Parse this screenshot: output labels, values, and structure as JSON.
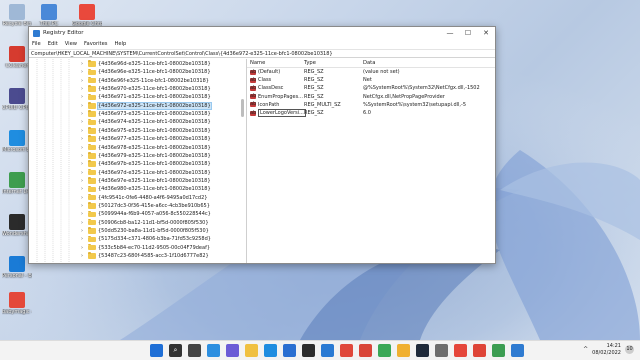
{
  "window": {
    "title": "Registry Editor",
    "menu": [
      "File",
      "Edit",
      "View",
      "Favorites",
      "Help"
    ],
    "address": "Computer\\HKEY_LOCAL_MACHINE\\SYSTEM\\CurrentControlSet\\Control\\Class\\{4d36e972-e325-11ce-bfc1-08002be10318}",
    "min": "—",
    "max": "☐",
    "close": "✕"
  },
  "tree": {
    "items": [
      {
        "key": "{4d36e96d-e325-11ce-bfc1-08002be10318}"
      },
      {
        "key": "{4d36e96e-e325-11ce-bfc1-08002be10318}"
      },
      {
        "key": "{4d36e96f-e325-11ce-bfc1-08002be10318}"
      },
      {
        "key": "{4d36e970-e325-11ce-bfc1-08002be10318}"
      },
      {
        "key": "{4d36e971-e325-11ce-bfc1-08002be10318}"
      },
      {
        "key": "{4d36e972-e325-11ce-bfc1-08002be10318}",
        "selected": true
      },
      {
        "key": "{4d36e973-e325-11ce-bfc1-08002be10318}"
      },
      {
        "key": "{4d36e974-e325-11ce-bfc1-08002be10318}"
      },
      {
        "key": "{4d36e975-e325-11ce-bfc1-08002be10318}"
      },
      {
        "key": "{4d36e977-e325-11ce-bfc1-08002be10318}"
      },
      {
        "key": "{4d36e978-e325-11ce-bfc1-08002be10318}"
      },
      {
        "key": "{4d36e979-e325-11ce-bfc1-08002be10318}"
      },
      {
        "key": "{4d36e97b-e325-11ce-bfc1-08002be10318}"
      },
      {
        "key": "{4d36e97d-e325-11ce-bfc1-08002be10318}"
      },
      {
        "key": "{4d36e97e-e325-11ce-bfc1-08002be10318}"
      },
      {
        "key": "{4d36e980-e325-11ce-bfc1-08002be10318}"
      },
      {
        "key": "{4fc9541c-0fe6-4480-a4f6-9495a0d17cd2}"
      },
      {
        "key": "{50127dc3-0f36-415e-a6cc-4cb3be910b65}"
      },
      {
        "key": "{5099944a-f6b9-4057-a056-8c550228544c}"
      },
      {
        "key": "{50906cb8-ba12-11d1-bf5d-0000f805f530}"
      },
      {
        "key": "{50dd5230-ba8a-11d1-bf5d-0000f805f530}"
      },
      {
        "key": "{5175d334-c371-4806-b3ba-71fd53c9258d}"
      },
      {
        "key": "{533c5b84-ec70-11d2-9505-00c04F79deaf}"
      },
      {
        "key": "{53487c23-680f-4585-acc3-1f10d6777e82}"
      }
    ]
  },
  "values": {
    "headers": {
      "name": "Name",
      "type": "Type",
      "data": "Data"
    },
    "rows": [
      {
        "name": "(Default)",
        "type": "REG_SZ",
        "data": "(value not set)"
      },
      {
        "name": "Class",
        "type": "REG_SZ",
        "data": "Net"
      },
      {
        "name": "ClassDesc",
        "type": "REG_SZ",
        "data": "@%SystemRoot%\\System32\\NetCfgx.dll,-1502"
      },
      {
        "name": "EnumPropPages...",
        "type": "REG_SZ",
        "data": "NetCfgx.dll,NetPropPageProvider"
      },
      {
        "name": "IconPath",
        "type": "REG_MULTI_SZ",
        "data": "%SystemRoot%\\system32\\setupapi.dll,-5"
      },
      {
        "name": "LowerLogoVersi...",
        "type": "REG_SZ",
        "data": "6.0",
        "editing": true
      }
    ]
  },
  "desktop": {
    "icons": [
      {
        "label": "Recycle Bin",
        "color": "#9fb8d6"
      },
      {
        "label": "This PC",
        "color": "#4a89d8"
      },
      {
        "label": "Google Chrome",
        "color": "#e9493c"
      },
      {
        "label": "CCleaner",
        "color": "#d63b2f"
      },
      {
        "label": "CPUID CPU-Z",
        "color": "#4b4b8f"
      },
      {
        "label": "Microsoft Edge",
        "color": "#1f8de0"
      },
      {
        "label": "Internet Download",
        "color": "#3e9d4f"
      },
      {
        "label": "Wondershare Filmora",
        "color": "#2b2b2b"
      },
      {
        "label": "Personal - Edge",
        "color": "#1a7bd6"
      },
      {
        "label": "babymagic - Chrome",
        "color": "#e4483a"
      }
    ]
  },
  "taskbar": {
    "icons": [
      {
        "name": "start-icon",
        "glyph": "",
        "color": "#1f6fd6"
      },
      {
        "name": "search-icon",
        "glyph": "⌕",
        "color": "#333333"
      },
      {
        "name": "task-view-icon",
        "glyph": "",
        "color": "#444444"
      },
      {
        "name": "widgets-icon",
        "glyph": "",
        "color": "#2d8fe0"
      },
      {
        "name": "chat-icon",
        "glyph": "",
        "color": "#6b5bd6"
      },
      {
        "name": "file-explorer-icon",
        "glyph": "",
        "color": "#f0c040"
      },
      {
        "name": "edge-icon",
        "glyph": "",
        "color": "#1f8de0"
      },
      {
        "name": "store-icon",
        "glyph": "",
        "color": "#2a6fd1"
      },
      {
        "name": "terminal-icon",
        "glyph": "",
        "color": "#2c2c2c"
      },
      {
        "name": "vscode-icon",
        "glyph": "",
        "color": "#2a7ad3"
      },
      {
        "name": "chrome-icon",
        "glyph": "",
        "color": "#e0483b"
      },
      {
        "name": "chrome-2-icon",
        "glyph": "",
        "color": "#d94538"
      },
      {
        "name": "chrome-3-icon",
        "glyph": "",
        "color": "#3aa857"
      },
      {
        "name": "chrome-4-icon",
        "glyph": "",
        "color": "#f0b030"
      },
      {
        "name": "filmora-icon",
        "glyph": "",
        "color": "#1f2a3a"
      },
      {
        "name": "settings-icon",
        "glyph": "",
        "color": "#6d6d6d"
      },
      {
        "name": "chrome-5-icon",
        "glyph": "",
        "color": "#e5463a"
      },
      {
        "name": "chrome-6-icon",
        "glyph": "",
        "color": "#de4437"
      },
      {
        "name": "chrome-7-icon",
        "glyph": "",
        "color": "#3c9d52"
      },
      {
        "name": "regedit-icon",
        "glyph": "",
        "color": "#2f7bd1"
      }
    ],
    "tray_arrow": "^",
    "time": "14:21",
    "date": "08/02/2022",
    "notifications": "10"
  }
}
